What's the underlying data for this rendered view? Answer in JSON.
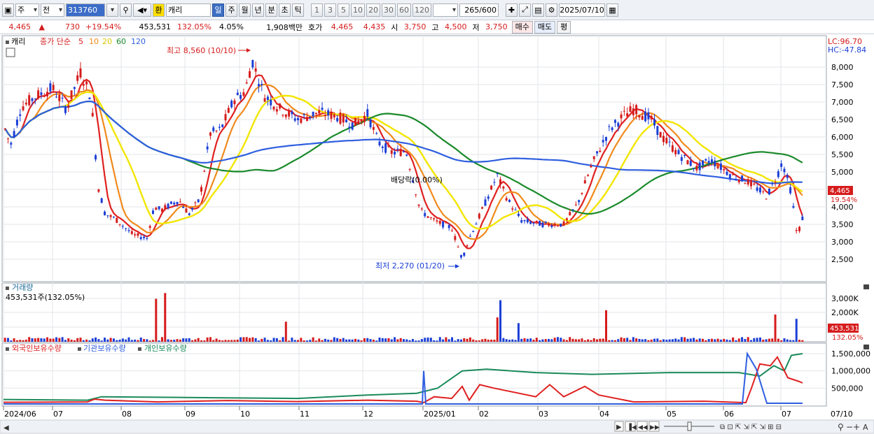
{
  "toolbar": {
    "market": "주",
    "scope": "전",
    "code": "313760",
    "name_tag": "환",
    "name": "캐리",
    "periods": [
      "일",
      "주",
      "월",
      "년",
      "분",
      "초",
      "틱"
    ],
    "active_period": "일",
    "intervals": [
      "1",
      "3",
      "5",
      "10",
      "20",
      "30",
      "60",
      "120"
    ],
    "count": "265",
    "count_max": "/600",
    "date": "2025/07/10"
  },
  "quote": {
    "price": "4,465",
    "change_arrow": "▲",
    "change": "730",
    "change_pct": "+19.54%",
    "volume": "453,531",
    "volume_ratio": "132.05%",
    "turnover": "4.05%",
    "amount": "1,908백만",
    "bid_label": "호가",
    "ask_price": "4,465",
    "bid_price": "4,435",
    "open_label": "시",
    "open": "3,750",
    "high_label": "고",
    "high": "4,500",
    "low_label": "저",
    "low": "3,750",
    "buy_btn": "매수",
    "sell_btn": "매도",
    "eval_btn": "평"
  },
  "price_pane": {
    "title": "캐리",
    "ma_label": "종가 단순",
    "ma_periods": [
      {
        "p": "5",
        "color": "#e02020"
      },
      {
        "p": "10",
        "color": "#f08a1c"
      },
      {
        "p": "20",
        "color": "#e8d800"
      },
      {
        "p": "60",
        "color": "#1a8a2a"
      },
      {
        "p": "120",
        "color": "#2f5fe0"
      }
    ],
    "lc": "LC:96.70",
    "hc": "HC:-47.84",
    "high_note": "최고 8,560 (10/10)",
    "low_note": "최저 2,270 (01/20)",
    "dividend_note": "배당락(0.00%)",
    "last_price_tag": "4,465",
    "last_pct_tag": "19.54%",
    "y_ticks": [
      "8,000",
      "7,500",
      "7,000",
      "6,500",
      "6,000",
      "5,500",
      "5,000",
      "4,500",
      "4,000",
      "3,500",
      "3,000",
      "2,500"
    ]
  },
  "volume_pane": {
    "title": "거래량",
    "value": "453,531주(132.05%)",
    "y_ticks": [
      "3,000K",
      "2,000K",
      "1,000K"
    ],
    "last_tag": "453,531",
    "last_pct": "132.05%"
  },
  "holder_pane": {
    "series": [
      {
        "name": "외국인보유수량",
        "color": "#e02020"
      },
      {
        "name": "기관보유수량",
        "color": "#2f5fe0"
      },
      {
        "name": "개인보유수량",
        "color": "#1a8a5a"
      }
    ],
    "y_ticks": [
      "1,500,000",
      "1,000,000",
      "500,000"
    ]
  },
  "x_axis": [
    "2024/06",
    "07",
    "08",
    "09",
    "10",
    "11",
    "12",
    "2025/01",
    "02",
    "03",
    "04",
    "05",
    "06",
    "07"
  ],
  "x_right": "07/10",
  "colors": {
    "up": "#d61c1c",
    "down": "#1c3fd6"
  }
}
